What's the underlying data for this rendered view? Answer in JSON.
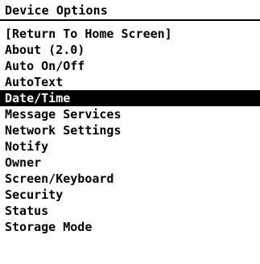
{
  "header": {
    "title": "Device Options"
  },
  "menu": {
    "selected_index": 5,
    "items": [
      {
        "label": "[Return To Home Screen]"
      },
      {
        "label": "About (2.0)"
      },
      {
        "label": "Auto On/Off"
      },
      {
        "label": "AutoText"
      },
      {
        "label": "Date/Time"
      },
      {
        "label": "Message Services"
      },
      {
        "label": "Network Settings"
      },
      {
        "label": "Notify"
      },
      {
        "label": "Owner"
      },
      {
        "label": "Screen/Keyboard"
      },
      {
        "label": "Security"
      },
      {
        "label": "Status"
      },
      {
        "label": "Storage Mode"
      }
    ]
  },
  "colors": {
    "background": "#ffffff",
    "text": "#000000",
    "selection_background": "#000000",
    "selection_text": "#ffffff"
  }
}
